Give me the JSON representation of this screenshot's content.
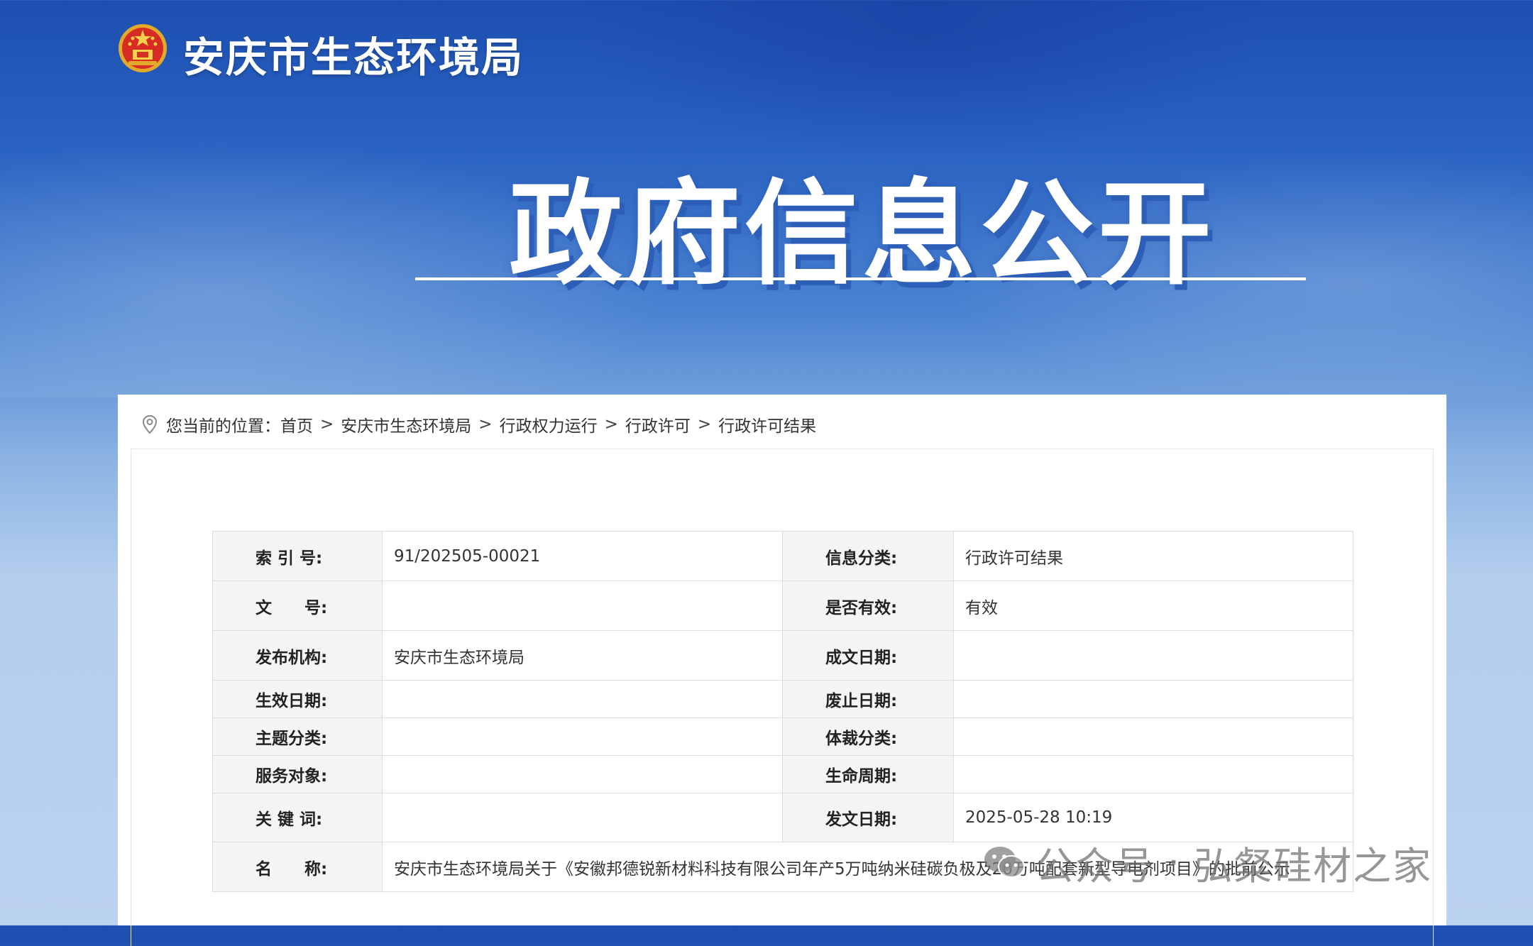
{
  "header": {
    "site_name": "安庆市生态环境局",
    "banner_title": "政府信息公开"
  },
  "breadcrumb": {
    "prefix": "您当前的位置：",
    "items": [
      "首页",
      "安庆市生态环境局",
      "行政权力运行",
      "行政许可",
      "行政许可结果"
    ],
    "separator": ">"
  },
  "info": {
    "index_no": {
      "label": "索 引 号:",
      "value": "91/202505-00021"
    },
    "category": {
      "label": "信息分类:",
      "value": "行政许可结果"
    },
    "doc_no": {
      "label": "文　　号:",
      "value": ""
    },
    "validity": {
      "label": "是否有效:",
      "value": "有效"
    },
    "publisher": {
      "label": "发布机构:",
      "value": "安庆市生态环境局"
    },
    "written_date": {
      "label": "成文日期:",
      "value": ""
    },
    "effective_date": {
      "label": "生效日期:",
      "value": ""
    },
    "expiry_date": {
      "label": "废止日期:",
      "value": ""
    },
    "topic": {
      "label": "主题分类:",
      "value": ""
    },
    "genre": {
      "label": "体裁分类:",
      "value": ""
    },
    "audience": {
      "label": "服务对象:",
      "value": ""
    },
    "lifecycle": {
      "label": "生命周期:",
      "value": ""
    },
    "keywords": {
      "label": "关 键 词:",
      "value": ""
    },
    "issue_date": {
      "label": "发文日期:",
      "value": "2025-05-28 10:19"
    },
    "name": {
      "label": "名　　称:",
      "value": "安庆市生态环境局关于《安徽邦德锐新材料科技有限公司年产5万吨纳米硅碳负极及20万吨配套新型导电剂项目》的批前公示"
    }
  },
  "watermark": {
    "left": "公众号",
    "right": "弘粲硅材之家"
  },
  "colors": {
    "banner_top": "#1d4fb0",
    "banner_bottom": "#bcd3f0",
    "label_bg": "#f4f4f4",
    "border": "#dedede"
  },
  "icons": {
    "logo": "national-emblem-icon",
    "breadcrumb": "location-pin-icon",
    "watermark": "wechat-icon"
  }
}
